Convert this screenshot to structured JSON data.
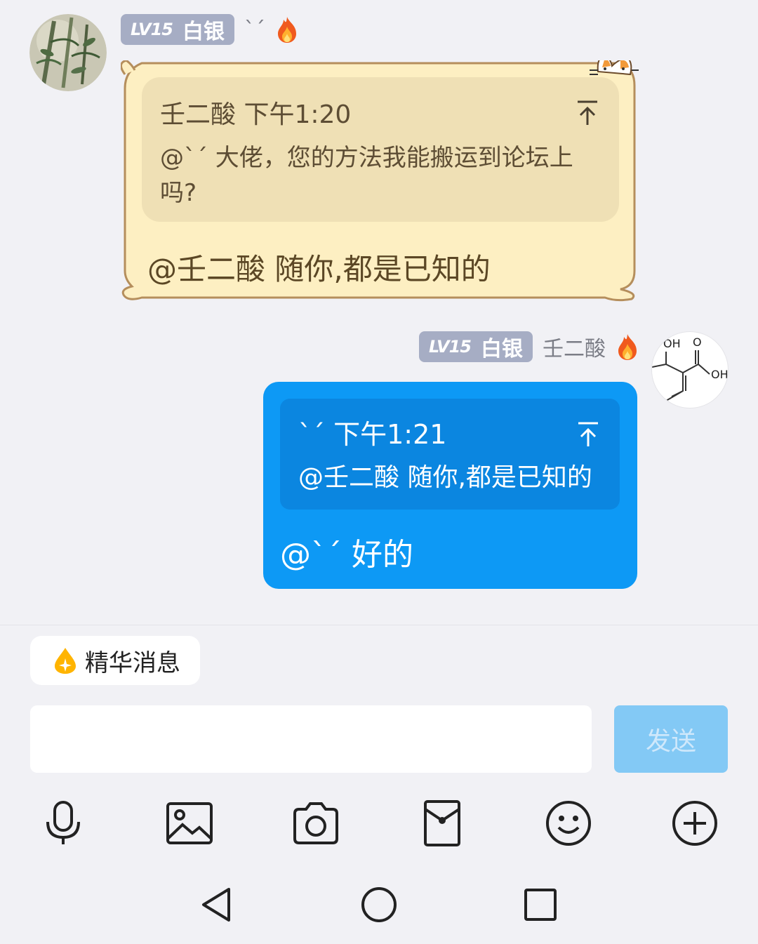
{
  "messages": [
    {
      "sender": {
        "level": "LV15",
        "title": "白银",
        "name": "ˋˊ"
      },
      "quote": {
        "author": "壬二酸",
        "time": "下午1:20",
        "text": "@ˋˊ 大佬，您的方法我能搬运到论坛上吗?"
      },
      "text": "@壬二酸 随你,都是已知的"
    },
    {
      "sender": {
        "level": "LV15",
        "title": "白银",
        "name": "壬二酸"
      },
      "quote": {
        "author": "ˋˊ",
        "time": "下午1:21",
        "text": "@壬二酸 随你,都是已知的"
      },
      "text": "@ˋˊ 好的"
    }
  ],
  "avatar_right": {
    "labels": [
      "OH",
      "O",
      "OH"
    ]
  },
  "essence": {
    "label": "精华消息"
  },
  "input": {
    "value": "",
    "placeholder": ""
  },
  "send": {
    "label": "发送"
  },
  "toolbar": [
    "microphone-icon",
    "image-icon",
    "camera-icon",
    "red-envelope-icon",
    "emoji-icon",
    "plus-icon"
  ],
  "nav": [
    "back-icon",
    "home-icon",
    "recents-icon"
  ],
  "colors": {
    "background": "#f1f1f5",
    "outgoing_bubble": "#0d99f5",
    "outgoing_quote": "#0b86e0",
    "incoming_bubble": "#fdefc2",
    "incoming_quote": "#efe0b5",
    "badge": "#a6adc4",
    "send_button": "#83c9f5"
  }
}
